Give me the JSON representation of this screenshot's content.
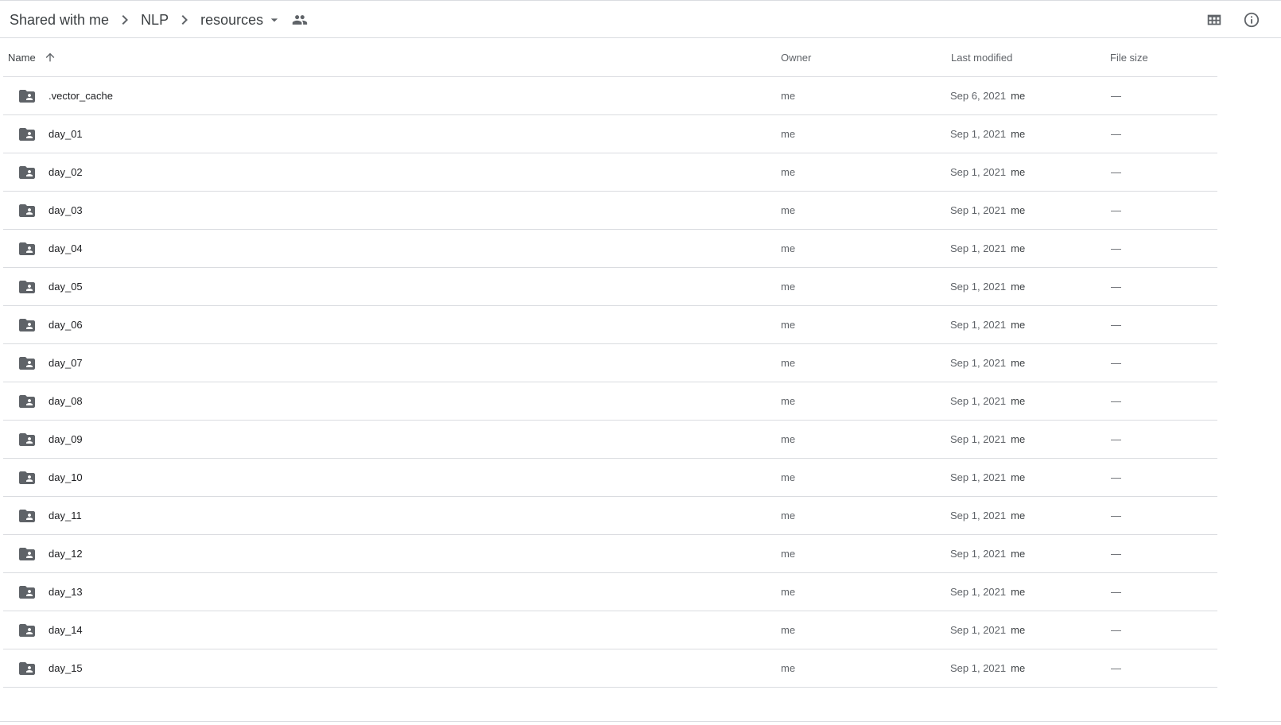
{
  "breadcrumb": {
    "items": [
      "Shared with me",
      "NLP"
    ],
    "current": "resources"
  },
  "icons": {
    "separator": "chevron-right-icon",
    "caret": "arrow-drop-down-icon",
    "shared": "people-icon",
    "grid": "grid-view-icon",
    "info": "info-icon",
    "folder": "shared-folder-icon",
    "sort": "arrow-upward-icon"
  },
  "table": {
    "columns": {
      "name": "Name",
      "owner": "Owner",
      "modified": "Last modified",
      "size": "File size"
    },
    "sort": "ascending",
    "rows": [
      {
        "name": ".vector_cache",
        "owner": "me",
        "modified": "Sep 6, 2021",
        "modified_by": "me",
        "size": "—"
      },
      {
        "name": "day_01",
        "owner": "me",
        "modified": "Sep 1, 2021",
        "modified_by": "me",
        "size": "—"
      },
      {
        "name": "day_02",
        "owner": "me",
        "modified": "Sep 1, 2021",
        "modified_by": "me",
        "size": "—"
      },
      {
        "name": "day_03",
        "owner": "me",
        "modified": "Sep 1, 2021",
        "modified_by": "me",
        "size": "—"
      },
      {
        "name": "day_04",
        "owner": "me",
        "modified": "Sep 1, 2021",
        "modified_by": "me",
        "size": "—"
      },
      {
        "name": "day_05",
        "owner": "me",
        "modified": "Sep 1, 2021",
        "modified_by": "me",
        "size": "—"
      },
      {
        "name": "day_06",
        "owner": "me",
        "modified": "Sep 1, 2021",
        "modified_by": "me",
        "size": "—"
      },
      {
        "name": "day_07",
        "owner": "me",
        "modified": "Sep 1, 2021",
        "modified_by": "me",
        "size": "—"
      },
      {
        "name": "day_08",
        "owner": "me",
        "modified": "Sep 1, 2021",
        "modified_by": "me",
        "size": "—"
      },
      {
        "name": "day_09",
        "owner": "me",
        "modified": "Sep 1, 2021",
        "modified_by": "me",
        "size": "—"
      },
      {
        "name": "day_10",
        "owner": "me",
        "modified": "Sep 1, 2021",
        "modified_by": "me",
        "size": "—"
      },
      {
        "name": "day_11",
        "owner": "me",
        "modified": "Sep 1, 2021",
        "modified_by": "me",
        "size": "—"
      },
      {
        "name": "day_12",
        "owner": "me",
        "modified": "Sep 1, 2021",
        "modified_by": "me",
        "size": "—"
      },
      {
        "name": "day_13",
        "owner": "me",
        "modified": "Sep 1, 2021",
        "modified_by": "me",
        "size": "—"
      },
      {
        "name": "day_14",
        "owner": "me",
        "modified": "Sep 1, 2021",
        "modified_by": "me",
        "size": "—"
      },
      {
        "name": "day_15",
        "owner": "me",
        "modified": "Sep 1, 2021",
        "modified_by": "me",
        "size": "—"
      }
    ]
  },
  "colors": {
    "text": "#202124",
    "secondary_text": "#5f6368",
    "icon": "#5f6368",
    "divider": "#dadce0"
  }
}
